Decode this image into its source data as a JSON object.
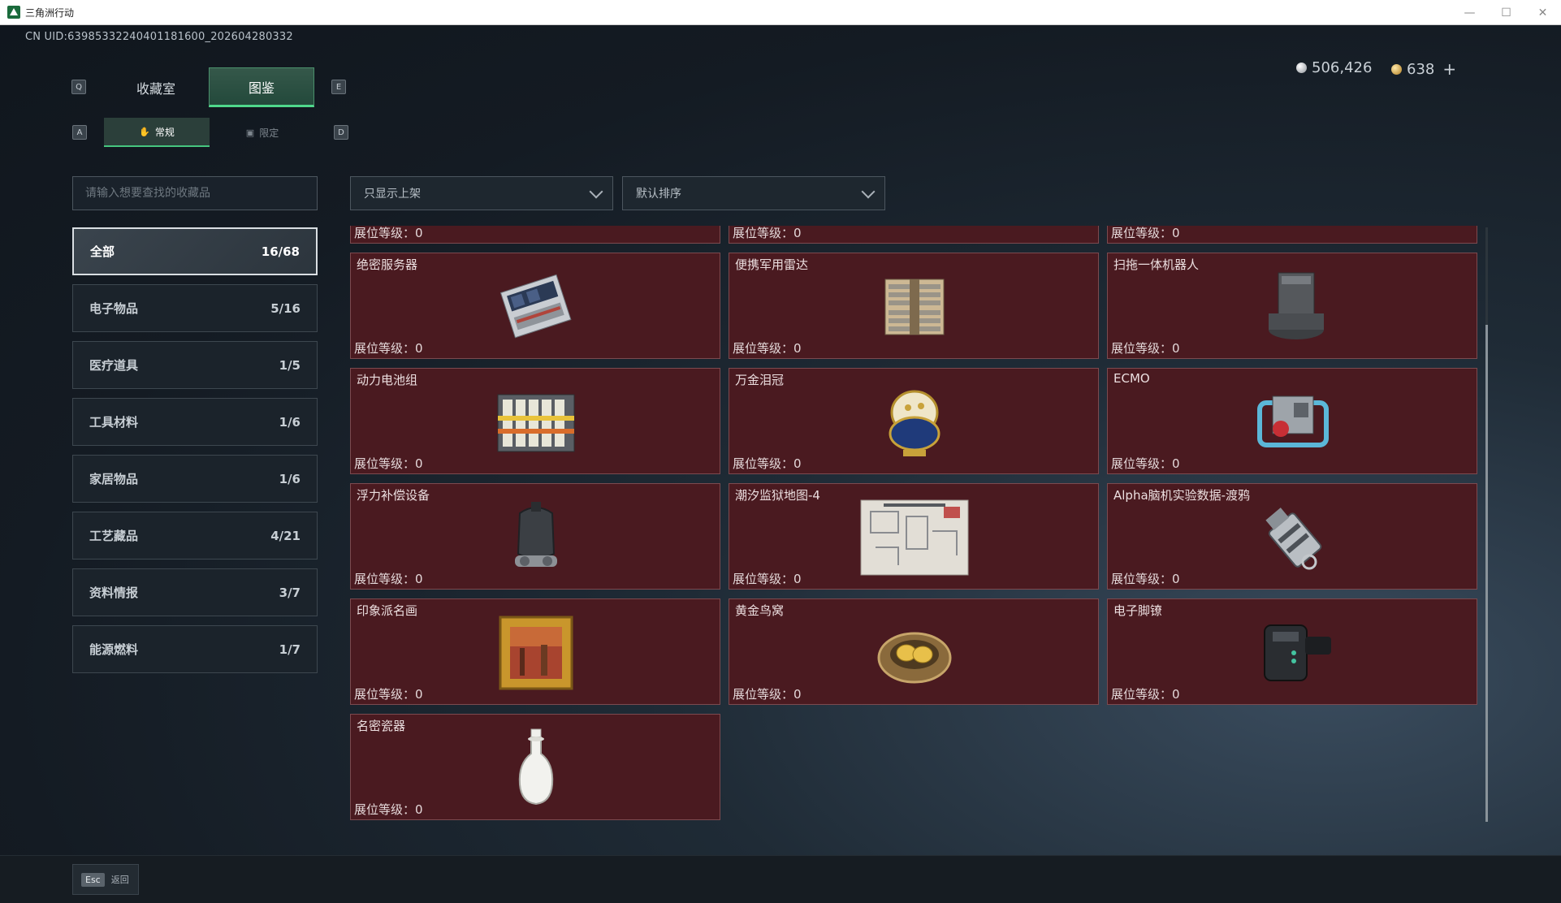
{
  "window": {
    "title": "三角洲行动",
    "minimize": "—",
    "maximize": "☐",
    "close": "✕"
  },
  "uid": "CN UID:6398533224040118160​0_202604280332",
  "currencies": {
    "silver": "506,426",
    "gold": "638",
    "add": "+"
  },
  "keys": {
    "q": "Q",
    "e": "E",
    "a": "A",
    "d": "D",
    "esc": "Esc"
  },
  "main_tabs": [
    {
      "label": "收藏室"
    },
    {
      "label": "图鉴"
    }
  ],
  "sub_tabs": [
    {
      "label": "常规",
      "icon": "✋"
    },
    {
      "label": "限定",
      "icon": "▣"
    }
  ],
  "search": {
    "placeholder": "请输入想要查找的收藏品",
    "value": ""
  },
  "filters": {
    "shelf_filter": "只显示上架",
    "sort": "默认排序"
  },
  "categories": [
    {
      "label": "全部",
      "count": "16/68"
    },
    {
      "label": "电子物品",
      "count": "5/16"
    },
    {
      "label": "医疗道具",
      "count": "1/5"
    },
    {
      "label": "工具材料",
      "count": "1/6"
    },
    {
      "label": "家居物品",
      "count": "1/6"
    },
    {
      "label": "工艺藏品",
      "count": "4/21"
    },
    {
      "label": "资料情报",
      "count": "3/7"
    },
    {
      "label": "能源燃料",
      "count": "1/7"
    }
  ],
  "level_label": "展位等级：",
  "partial_row": [
    {
      "level": "0"
    },
    {
      "level": "0"
    },
    {
      "level": "0"
    }
  ],
  "items": [
    {
      "name": "绝密服务器",
      "level": "0",
      "icon": "server-icon"
    },
    {
      "name": "便携军用雷达",
      "level": "0",
      "icon": "radar-icon"
    },
    {
      "name": "扫拖一体机器人",
      "level": "0",
      "icon": "robot-vacuum-icon"
    },
    {
      "name": "动力电池组",
      "level": "0",
      "icon": "battery-pack-icon"
    },
    {
      "name": "万金泪冠",
      "level": "0",
      "icon": "jeweled-egg-icon"
    },
    {
      "name": "ECMO",
      "level": "0",
      "icon": "ecmo-icon"
    },
    {
      "name": "浮力补偿设备",
      "level": "0",
      "icon": "bcd-icon"
    },
    {
      "name": "潮汐监狱地图-4",
      "level": "0",
      "icon": "map-icon"
    },
    {
      "name": "Alpha脑机实验数据-渡鸦",
      "level": "0",
      "icon": "usb-drive-icon"
    },
    {
      "name": "印象派名画",
      "level": "0",
      "icon": "painting-icon"
    },
    {
      "name": "黄金鸟窝",
      "level": "0",
      "icon": "golden-nest-icon"
    },
    {
      "name": "电子脚镣",
      "level": "0",
      "icon": "ankle-monitor-icon"
    },
    {
      "name": "名密瓷器",
      "level": "0",
      "icon": "porcelain-vase-icon"
    }
  ],
  "back_label": "返回"
}
